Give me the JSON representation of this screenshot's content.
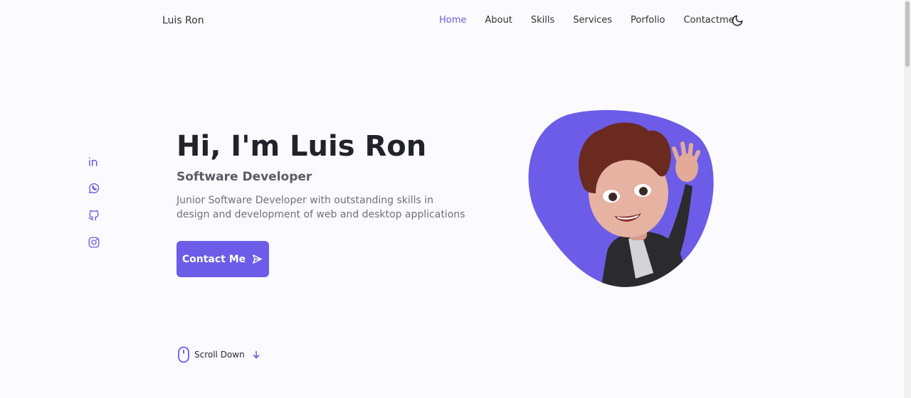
{
  "header": {
    "logo": "Luis Ron",
    "nav": [
      "Home",
      "About",
      "Skills",
      "Services",
      "Porfolio",
      "Contactme"
    ],
    "active_index": 0,
    "theme_icon": "moon-icon"
  },
  "socials": [
    "linkedin-icon",
    "whatsapp-icon",
    "github-icon",
    "instagram-icon"
  ],
  "hero": {
    "title": "Hi, I'm Luis Ron",
    "subtitle": "Software Developer",
    "description": "Junior Software Developer with outstanding skills in design and development of web and desktop applications",
    "cta_label": "Contact Me",
    "cta_icon": "send-icon",
    "image_icon": "profile-avatar"
  },
  "scroll": {
    "label": "Scroll Down",
    "icons": [
      "mouse-icon",
      "arrow-down-icon"
    ]
  },
  "colors": {
    "accent": "#6c5ce7",
    "background": "#fbfaff",
    "text": "#22222a"
  }
}
